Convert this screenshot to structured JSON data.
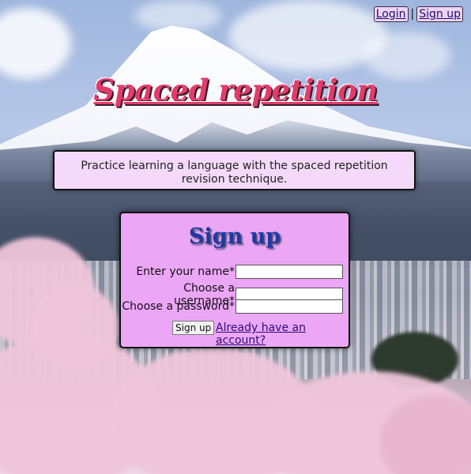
{
  "nav": {
    "login_label": "Login",
    "separator": "|",
    "signup_label": "Sign up"
  },
  "header": {
    "title": "Spaced repetition"
  },
  "intro": {
    "text": "Practice learning a language with the spaced repetition revision technique."
  },
  "signup_form": {
    "title": "Sign up",
    "name_label": "Enter your name*",
    "username_label": "Choose a username*",
    "password_label": "Choose a password*",
    "name_value": "",
    "username_value": "",
    "password_value": "",
    "submit_label": "Sign up",
    "login_link_label": "Already have an account?"
  },
  "colors": {
    "title": "#e23c6a",
    "card_background": "#eca6f6",
    "intro_background": "#f5d9fa",
    "card_title": "#1f3aa2",
    "link": "#2a0d78"
  }
}
